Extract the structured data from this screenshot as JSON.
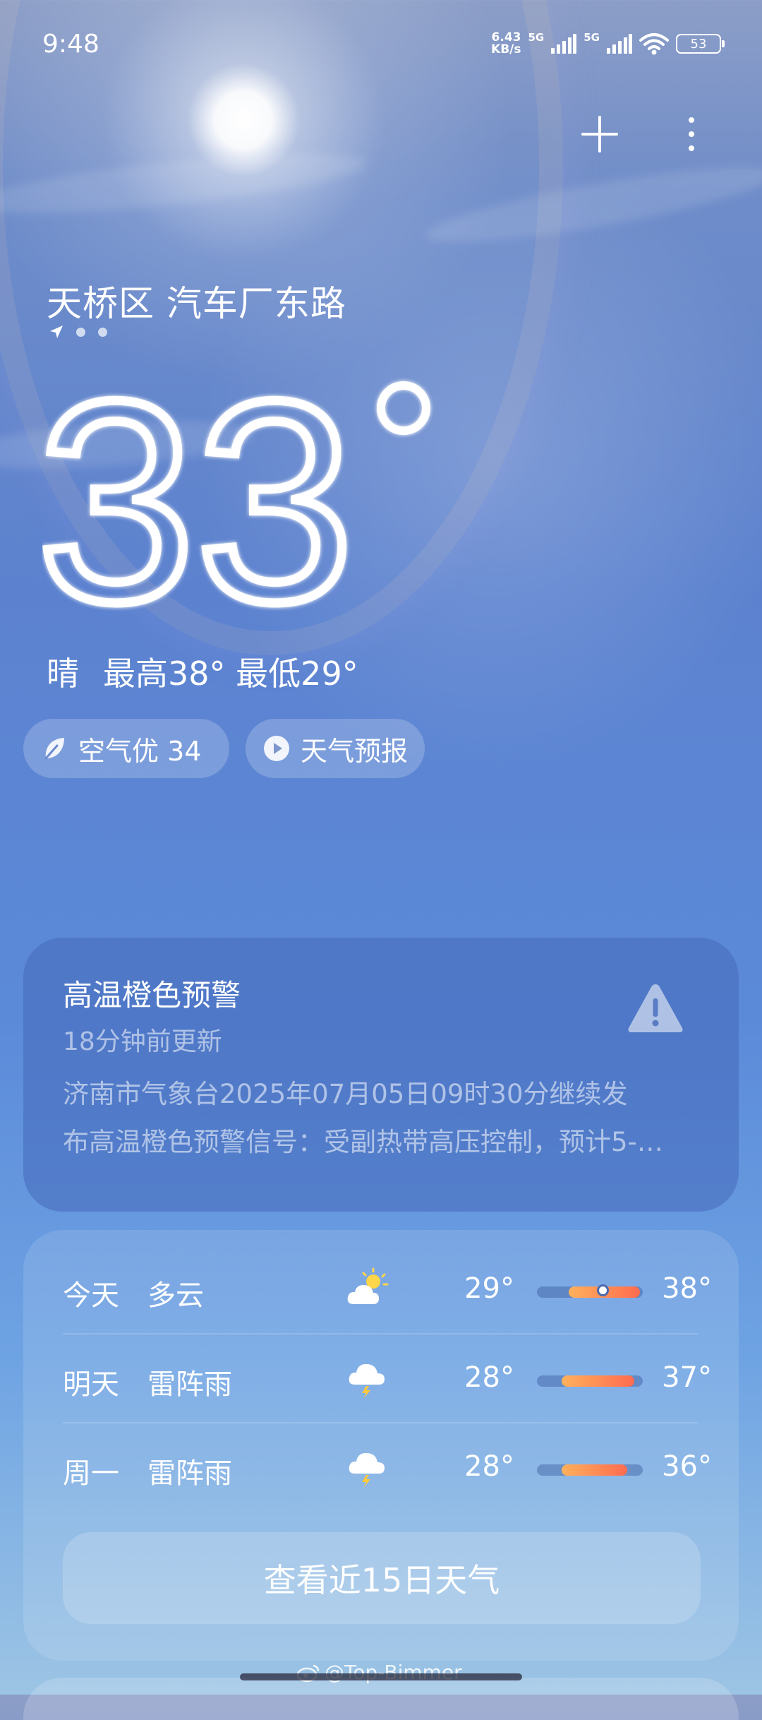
{
  "status_bar": {
    "time": "9:48",
    "net_speed_value": "6.43",
    "net_speed_unit": "KB/s",
    "network_1": "5G",
    "network_2": "5G",
    "battery": "53"
  },
  "header": {
    "location": "天桥区 汽车厂东路",
    "page_indicator": [
      "location-arrow-icon",
      "dot",
      "dot"
    ]
  },
  "current": {
    "temperature": "33",
    "condition": "晴",
    "high": "最高38°",
    "low": "最低29°"
  },
  "chips": {
    "aqi": "空气优 34",
    "forecast_video": "天气预报"
  },
  "warning": {
    "title": "高温橙色预警",
    "updated": "18分钟前更新",
    "body_line1": "济南市气象台2025年07月05日09时30分继续发",
    "body_line2": "布高温橙色预警信号：受副热带高压控制，预计5-…",
    "icon": "warning-triangle-icon"
  },
  "forecast": {
    "days": [
      {
        "day": "今天",
        "condition": "多云",
        "icon": "partly-cloudy-icon",
        "low": "29°",
        "high": "38°",
        "range_start": 0.3,
        "range_end": 0.97,
        "current_pos": 0.62
      },
      {
        "day": "明天",
        "condition": "雷阵雨",
        "icon": "thunderstorm-icon",
        "low": "28°",
        "high": "37°",
        "range_start": 0.23,
        "range_end": 0.92
      },
      {
        "day": "周一",
        "condition": "雷阵雨",
        "icon": "thunderstorm-icon",
        "low": "28°",
        "high": "36°",
        "range_start": 0.23,
        "range_end": 0.85
      }
    ],
    "button_label": "查看近15日天气"
  },
  "watermark": "@Top-Bimmer",
  "colors": {
    "sky_top": "#8c9ec7",
    "sky_mid": "#5c82cf",
    "sky_bottom": "#9cc4e4",
    "temp_bar_warm": "#ff6b4f",
    "temp_bar_cool": "#ffb15c"
  }
}
